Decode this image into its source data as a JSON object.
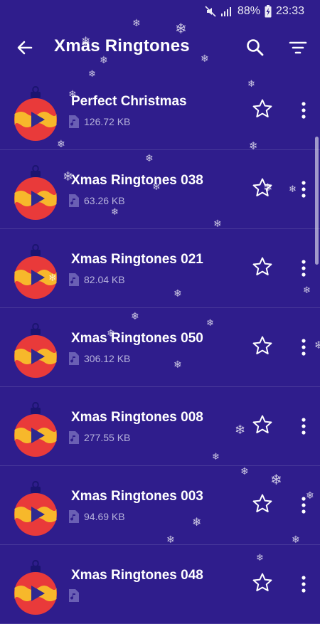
{
  "status_bar": {
    "battery_percent": "88%",
    "time": "23:33",
    "icons": [
      "mute-icon",
      "signal-icon",
      "battery-charging-icon"
    ]
  },
  "app_bar": {
    "title": "Xmas Ringtones",
    "icons": [
      "back-arrow-icon",
      "search-icon",
      "filter-icon"
    ]
  },
  "ringtones": [
    {
      "title": "Perfect Christmas",
      "size": "126.72 KB"
    },
    {
      "title": "Xmas Ringtones 038",
      "size": "63.26 KB"
    },
    {
      "title": "Xmas Ringtones 021",
      "size": "82.04 KB"
    },
    {
      "title": "Xmas Ringtones 050",
      "size": "306.12 KB"
    },
    {
      "title": "Xmas Ringtones 008",
      "size": "277.55 KB"
    },
    {
      "title": "Xmas Ringtones 003",
      "size": "94.69 KB"
    },
    {
      "title": "Xmas Ringtones 048",
      "size": ""
    }
  ],
  "colors": {
    "background": "#2f1d8c",
    "ornament_red": "#e93a3a",
    "ornament_yellow": "#f7b82b",
    "play_blue": "#2f2a8f"
  }
}
